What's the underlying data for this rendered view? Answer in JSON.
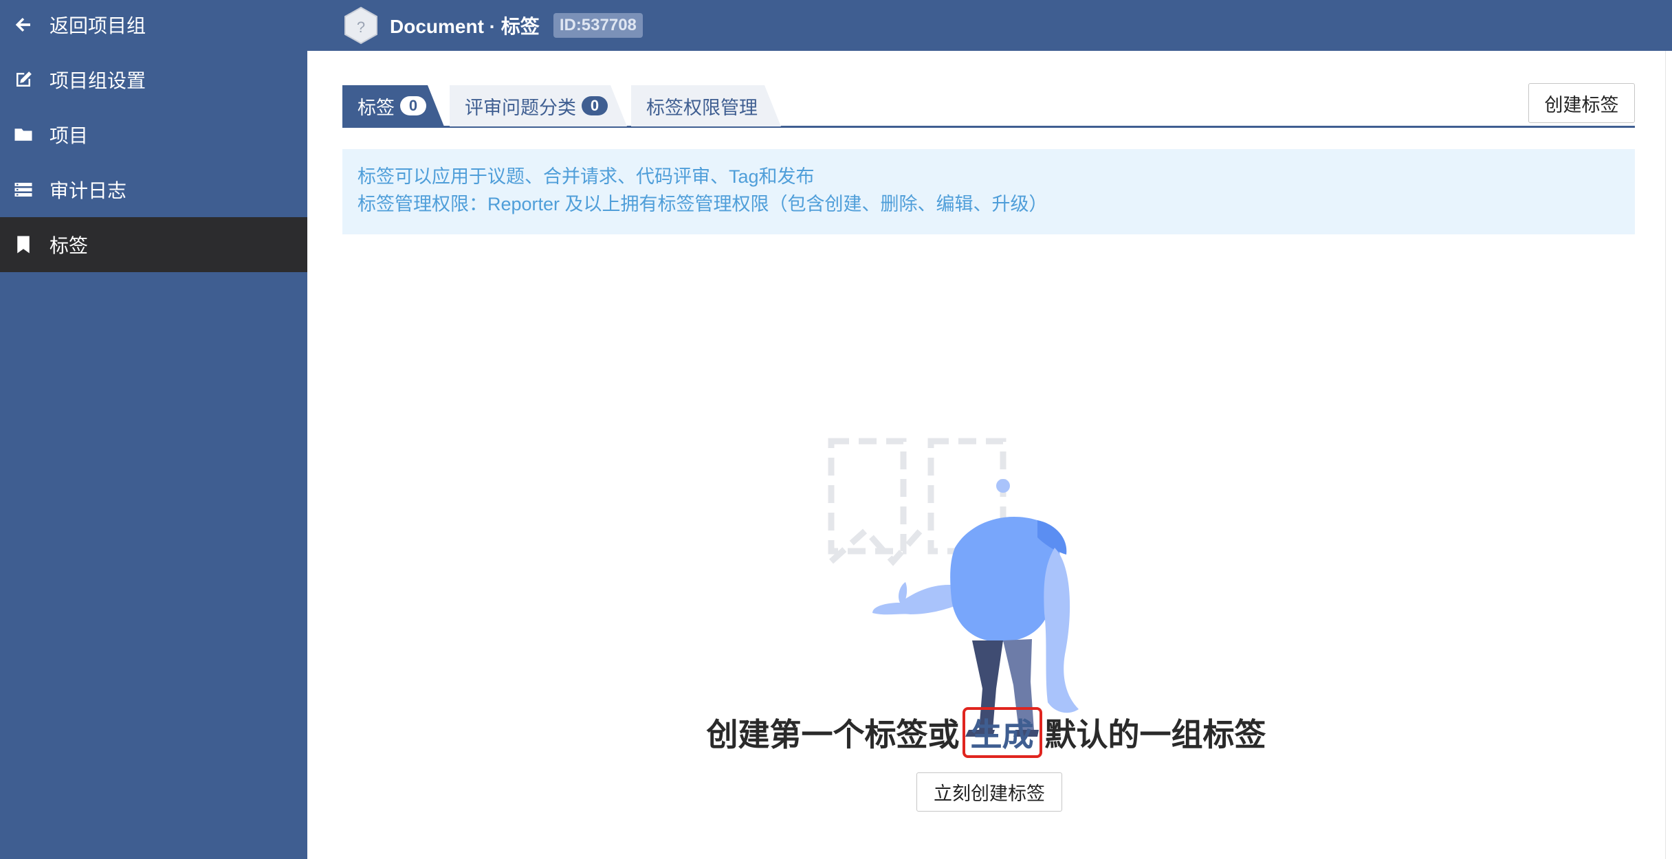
{
  "sidebar": {
    "items": [
      {
        "label": "返回项目组",
        "icon": "arrow-left-icon"
      },
      {
        "label": "项目组设置",
        "icon": "edit-icon"
      },
      {
        "label": "项目",
        "icon": "folder-icon"
      },
      {
        "label": "审计日志",
        "icon": "list-icon"
      },
      {
        "label": "标签",
        "icon": "bookmark-icon",
        "active": true
      }
    ]
  },
  "header": {
    "project_name": "Document",
    "separator": " · ",
    "section": "标签",
    "id": "ID:537708"
  },
  "tabs": [
    {
      "label": "标签",
      "count": "0",
      "active": true
    },
    {
      "label": "评审问题分类",
      "count": "0",
      "active": false
    },
    {
      "label": "标签权限管理",
      "active": false
    }
  ],
  "actions": {
    "create_label": "创建标签"
  },
  "info": {
    "line1": "标签可以应用于议题、合并请求、代码评审、Tag和发布",
    "line2": "标签管理权限：Reporter 及以上拥有标签管理权限（包含创建、删除、编辑、升级）"
  },
  "empty_state": {
    "title_before": "创建第一个标签或",
    "link": "生成",
    "title_after": "默认的一组标签",
    "button": "立刻创建标签"
  },
  "colors": {
    "brand": "#3f5e91",
    "active_sidebar": "#2c2c2e",
    "info_bg": "#e8f4fd",
    "info_text": "#4f9ed9",
    "highlight_box": "#e0251f"
  }
}
